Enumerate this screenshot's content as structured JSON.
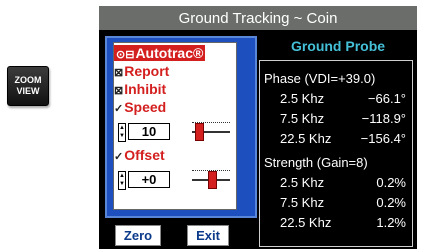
{
  "zoom": {
    "line1": "ZOOM",
    "line2": "VIEW"
  },
  "window": {
    "title": "Ground Tracking ~ Coin"
  },
  "menu": {
    "items": [
      {
        "label": "Autotrac®",
        "icon": "⊙⊟",
        "selected": true
      },
      {
        "label": "Report",
        "icon": "⊠",
        "selected": false
      },
      {
        "label": "Inhibit",
        "icon": "⊠",
        "selected": false
      },
      {
        "label": "Speed",
        "icon": "✓",
        "selected": false
      },
      {
        "label": "Offset",
        "icon": "✓",
        "selected": false
      }
    ],
    "speed_value": "10",
    "offset_value": "+0",
    "speed_level": 0.1,
    "offset_level": 0.5
  },
  "buttons": {
    "zero": "Zero",
    "exit": "Exit"
  },
  "probe": {
    "title": "Ground Probe",
    "phase_header": "Phase (VDI=+39.0)",
    "phase": [
      {
        "freq": "2.5 Khz",
        "value": "−66.1°"
      },
      {
        "freq": "7.5 Khz",
        "value": "−118.9°"
      },
      {
        "freq": "22.5 Khz",
        "value": "−156.4°"
      }
    ],
    "strength_header": "Strength (Gain=8)",
    "strength": [
      {
        "freq": "2.5 Khz",
        "value": "0.2%"
      },
      {
        "freq": "7.5 Khz",
        "value": "0.2%"
      },
      {
        "freq": "22.5 Khz",
        "value": "1.2%"
      }
    ]
  },
  "colors": {
    "accent_red": "#d41f1f",
    "panel_blue": "#1d4fbf",
    "title_cyan": "#44c0d8"
  }
}
